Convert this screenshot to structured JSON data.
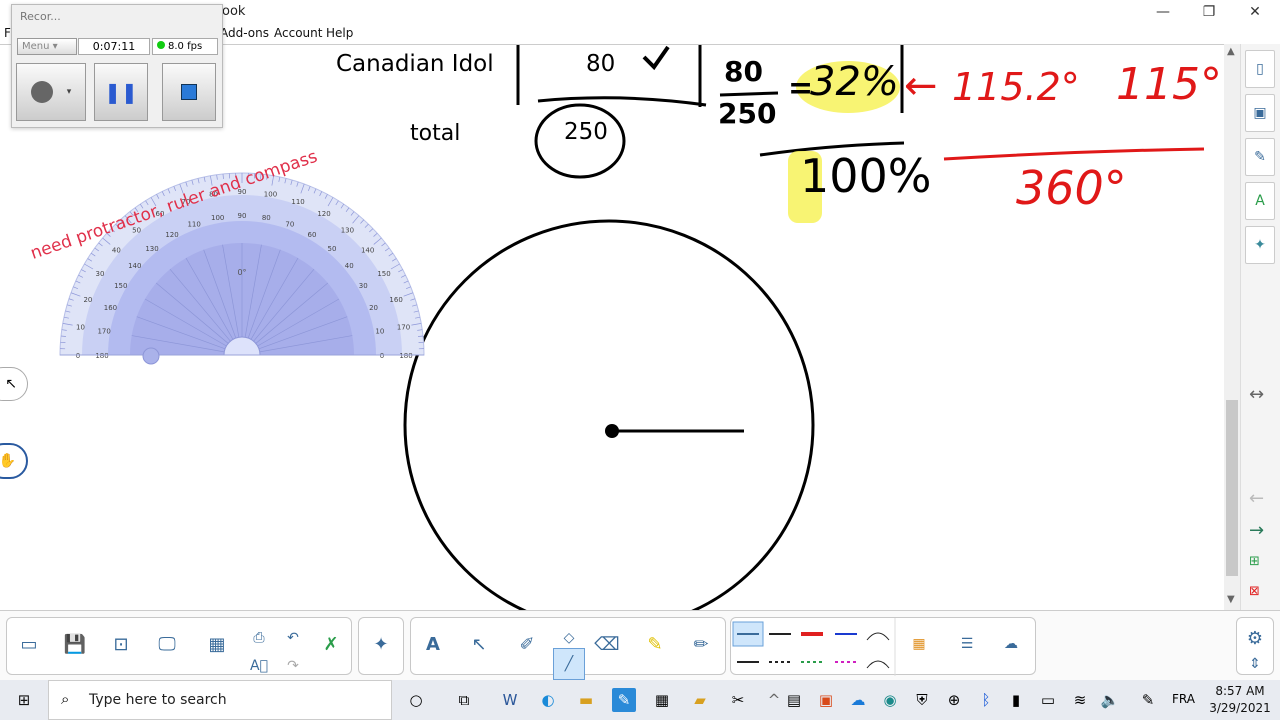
{
  "window": {
    "title": "ook",
    "minimize": "—",
    "restore": "❐",
    "close": "✕"
  },
  "menubar": {
    "items": [
      "Add-ons",
      "Account",
      "Help"
    ],
    "left_letter": "F"
  },
  "recorder": {
    "title": "Recor...",
    "menu_label": "Menu",
    "elapsed": "0:07:11",
    "fps": "8.0 fps",
    "fps_color": "#22cc22"
  },
  "whiteboard": {
    "row_label": "Canadian Idol",
    "row_value": "80",
    "total_label": "total",
    "total_value": "250",
    "fraction_num": "80",
    "fraction_den": "250",
    "equals": "=",
    "percent": "32%",
    "hundred_percent": "100%",
    "degrees_exact": "115.2°",
    "degrees_rounded": "115°",
    "degrees_total": "360°",
    "note": "need protractor, ruler and compass",
    "red_arrow": "←"
  },
  "protractor": {
    "outer_ticks": [
      "0",
      "10",
      "20",
      "30",
      "40",
      "50",
      "60",
      "70",
      "80",
      "90",
      "100",
      "110",
      "120",
      "130",
      "140",
      "150",
      "160",
      "170",
      "180"
    ],
    "zero_label": "0°"
  },
  "sidebar": {
    "tabs": [
      "page-sorter",
      "gallery",
      "attachments",
      "properties",
      "add-ons"
    ],
    "expand_label": "↔"
  },
  "toolbar": {
    "colors": {
      "blue": "#3a6b9a",
      "red": "#e02020",
      "green": "#2a9d4a",
      "magenta": "#d020c0"
    }
  },
  "taskbar": {
    "search_placeholder": "Type here to search",
    "language": "FRA",
    "time": "8:57 AM",
    "date": "3/29/2021"
  }
}
